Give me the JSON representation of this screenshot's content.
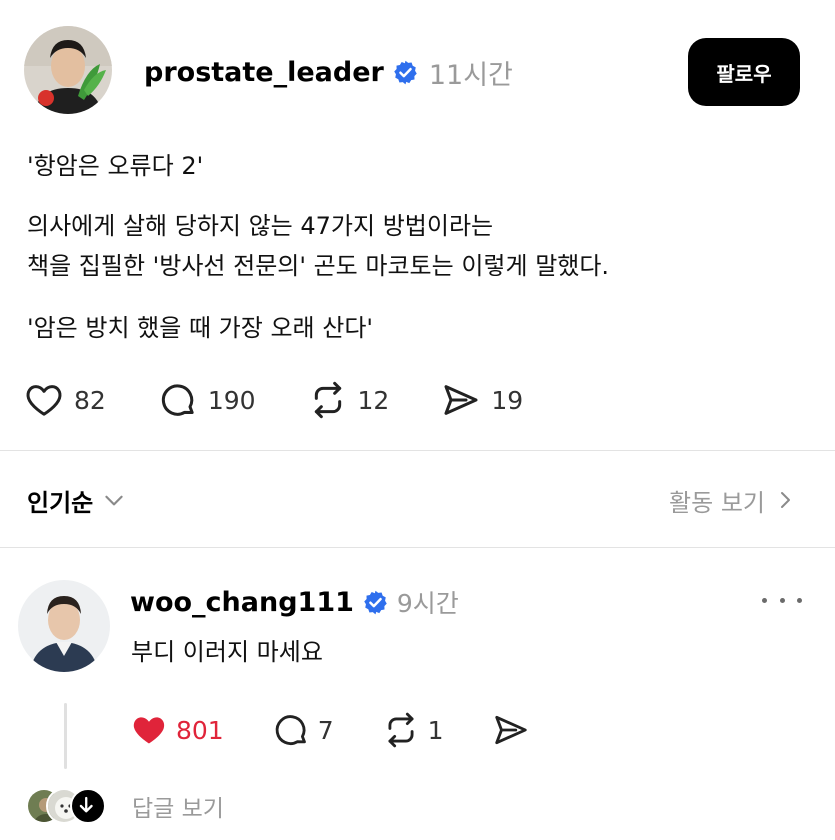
{
  "post": {
    "username": "prostate_leader",
    "time": "11시간",
    "follow_label": "팔로우",
    "paragraphs": {
      "p1": "'항암은 오류다 2'",
      "p2_line1": "의사에게 살해 당하지 않는 47가지 방법이라는",
      "p2_line2": "책을 집필한 '방사선 전문의' 곤도 마코토는 이렇게 말했다.",
      "p3": "'암은 방치 했을 때 가장 오래 산다'"
    },
    "counts": {
      "likes": "82",
      "comments": "190",
      "reposts": "12",
      "shares": "19"
    }
  },
  "sort": {
    "label": "인기순",
    "activity": "활동 보기"
  },
  "reply": {
    "username": "woo_chang111",
    "time": "9시간",
    "text": "부디 이러지 마세요",
    "counts": {
      "likes": "801",
      "comments": "7",
      "reposts": "1"
    },
    "view_replies": "답글 보기"
  },
  "colors": {
    "verified": "#2f6fed",
    "liked": "#e0243a",
    "muted": "#9a9a9a"
  },
  "icons": [
    "heart-icon",
    "comment-icon",
    "repost-icon",
    "share-icon",
    "verified-icon",
    "chevron-down-icon",
    "chevron-right-icon",
    "more-icon",
    "arrow-down-icon"
  ]
}
